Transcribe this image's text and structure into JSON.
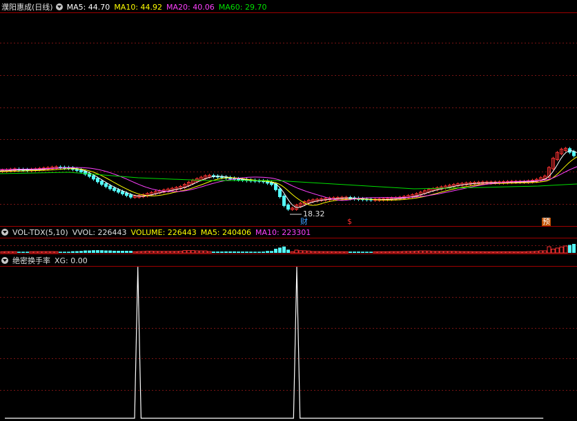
{
  "main_panel": {
    "title": "濮阳惠成(日线)",
    "indicators": [
      {
        "label": "MA5: 44.70",
        "color": "#ffffff"
      },
      {
        "label": "MA10: 44.92",
        "color": "#ffff00"
      },
      {
        "label": "MA20: 40.06",
        "color": "#ff40ff"
      },
      {
        "label": "MA60: 29.70",
        "color": "#00e000"
      }
    ],
    "price_annotation": "18.32",
    "event_markers": [
      {
        "glyph": "财",
        "color": "#40a0ff",
        "bg": ""
      },
      {
        "glyph": "$",
        "color": "#ff3030",
        "bg": ""
      },
      {
        "glyph": "预",
        "color": "#ffffff",
        "bg": "#c05000"
      }
    ]
  },
  "volume_panel": {
    "title": "VOL-TDX(5,10)",
    "indicators": [
      {
        "label": "VVOL: 226443",
        "color": "#e0e0e0"
      },
      {
        "label": "VOLUME: 226443",
        "color": "#ffff00"
      },
      {
        "label": "MA5: 240406",
        "color": "#ffff00"
      },
      {
        "label": "MA10: 223301",
        "color": "#ff40ff"
      }
    ]
  },
  "signal_panel": {
    "title": "绝密换手率",
    "indicators": [
      {
        "label": "XG: 0.00",
        "color": "#e0e0e0"
      }
    ]
  },
  "chart_data": {
    "type": "line",
    "title": "濮阳惠成(日线)",
    "series": [
      {
        "name": "XG",
        "values": [
          0,
          0,
          0,
          0,
          0,
          0,
          0,
          0,
          0,
          0,
          0,
          0,
          0,
          0,
          0,
          0,
          0,
          0,
          0,
          0,
          0,
          0,
          0,
          0,
          0,
          0,
          0,
          0,
          0,
          0,
          0,
          0,
          0,
          0,
          0,
          0,
          0,
          0,
          0,
          0,
          0,
          1,
          0,
          0,
          0,
          0,
          0,
          0,
          0,
          0,
          0,
          0,
          0,
          0,
          0,
          0,
          0,
          0,
          0,
          0,
          0,
          0,
          0,
          0,
          0,
          0,
          0,
          0,
          0,
          0,
          0,
          0,
          0,
          0,
          0,
          0,
          0,
          0,
          0,
          0,
          0,
          0,
          0,
          0,
          0,
          0,
          0,
          0,
          0,
          0,
          1,
          0,
          0,
          0,
          0,
          0,
          0,
          0,
          0,
          0,
          0,
          0,
          0,
          0,
          0,
          0,
          0,
          0,
          0,
          0,
          0,
          0,
          0,
          0,
          0,
          0,
          0,
          0,
          0,
          0,
          0,
          0,
          0,
          0,
          0,
          0,
          0,
          0,
          0,
          0,
          0,
          0,
          0,
          0,
          0,
          0,
          0,
          0,
          0,
          0,
          0,
          0,
          0,
          0,
          0,
          0,
          0,
          0,
          0,
          0,
          0,
          0,
          0,
          0,
          0,
          0,
          0,
          0,
          0,
          0,
          0,
          0,
          0,
          0,
          0,
          0,
          0
        ]
      }
    ],
    "colors": {
      "up": "#ff3232",
      "down": "#54fcfc",
      "grid": "#7a1414",
      "axis": "#a00000",
      "signal": "#ffffff"
    }
  }
}
